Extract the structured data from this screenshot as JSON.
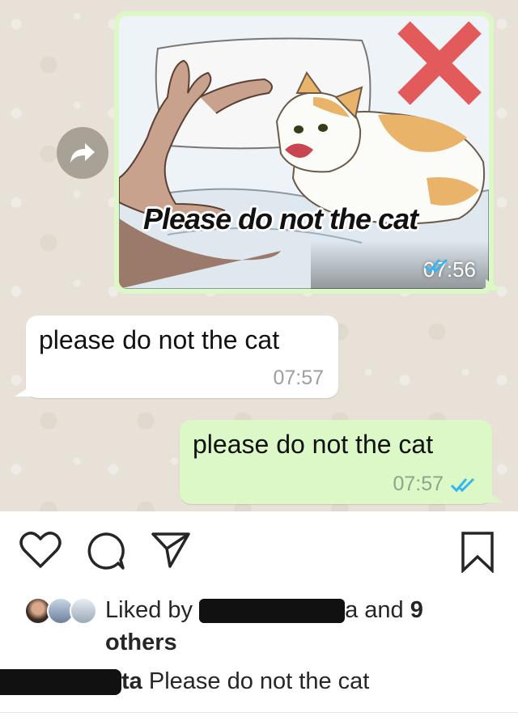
{
  "chat": {
    "image_message": {
      "caption": "Please do not the cat",
      "time": "07:56",
      "status": "read",
      "status_icon": "double-check-icon",
      "status_color": "#34b7f1"
    },
    "incoming_message": {
      "text": "please do not the cat",
      "time": "07:57"
    },
    "outgoing_message": {
      "text": "please do not the cat",
      "time": "07:57",
      "status": "read",
      "status_icon": "double-check-icon",
      "status_color": "#34b7f1"
    },
    "forward_icon": "forward-arrow-icon",
    "bubble_green": "#dcf8c6",
    "wallpaper": "#e7e1d8"
  },
  "instagram": {
    "actions": [
      "heart-icon",
      "comment-icon",
      "share-icon",
      "bookmark-icon"
    ],
    "likes": {
      "prefix": "Liked by",
      "suffix_fragment": "a",
      "and_text": "and",
      "count": "9",
      "others": "others"
    },
    "caption": {
      "username_fragment": "ta",
      "text": "Please do not the cat"
    }
  }
}
